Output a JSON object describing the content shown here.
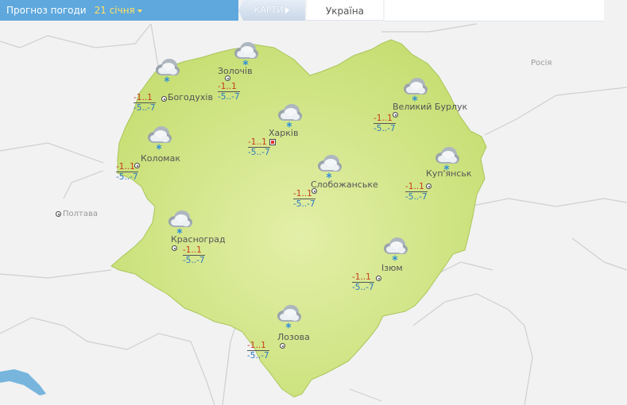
{
  "header": {
    "title": "Прогноз погоди",
    "date": "21 січня",
    "maps_label": "КАРТИ",
    "region": "Україна"
  },
  "labels": {
    "russia": "Росія",
    "poltava": "Полтава"
  },
  "cities": [
    {
      "name": "Богодухів",
      "day": "-1..1",
      "night": "-5..-7"
    },
    {
      "name": "Золочів",
      "day": "-1..1",
      "night": "-5..-7"
    },
    {
      "name": "Великий Бурлук",
      "day": "-1..1",
      "night": "-5..-7"
    },
    {
      "name": "Харків",
      "day": "-1..1",
      "night": "-5..-7"
    },
    {
      "name": "Коломак",
      "day": "-1..1",
      "night": "-5..-7"
    },
    {
      "name": "Слобожанське",
      "day": "-1..1",
      "night": "-5..-7"
    },
    {
      "name": "Куп'янськ",
      "day": "-1..1",
      "night": "-5..-7"
    },
    {
      "name": "Красноград",
      "day": "-1..1",
      "night": "-5..-7"
    },
    {
      "name": "Ізюм",
      "day": "-1..1",
      "night": "-5..-7"
    },
    {
      "name": "Лозова",
      "day": "-1..1",
      "night": "-5..-7"
    }
  ],
  "icons": {
    "weather": "cloud-snow-icon",
    "city_marker": "city-dot-icon",
    "capital_marker": "regional-center-icon"
  },
  "colors": {
    "region_fill": "#c9e07a",
    "background": "#f2f2f2",
    "header_blue": "#5ea8dd",
    "date_yellow": "#ffe066",
    "day_temp": "#c83c1e",
    "night_temp": "#2a78c0"
  }
}
